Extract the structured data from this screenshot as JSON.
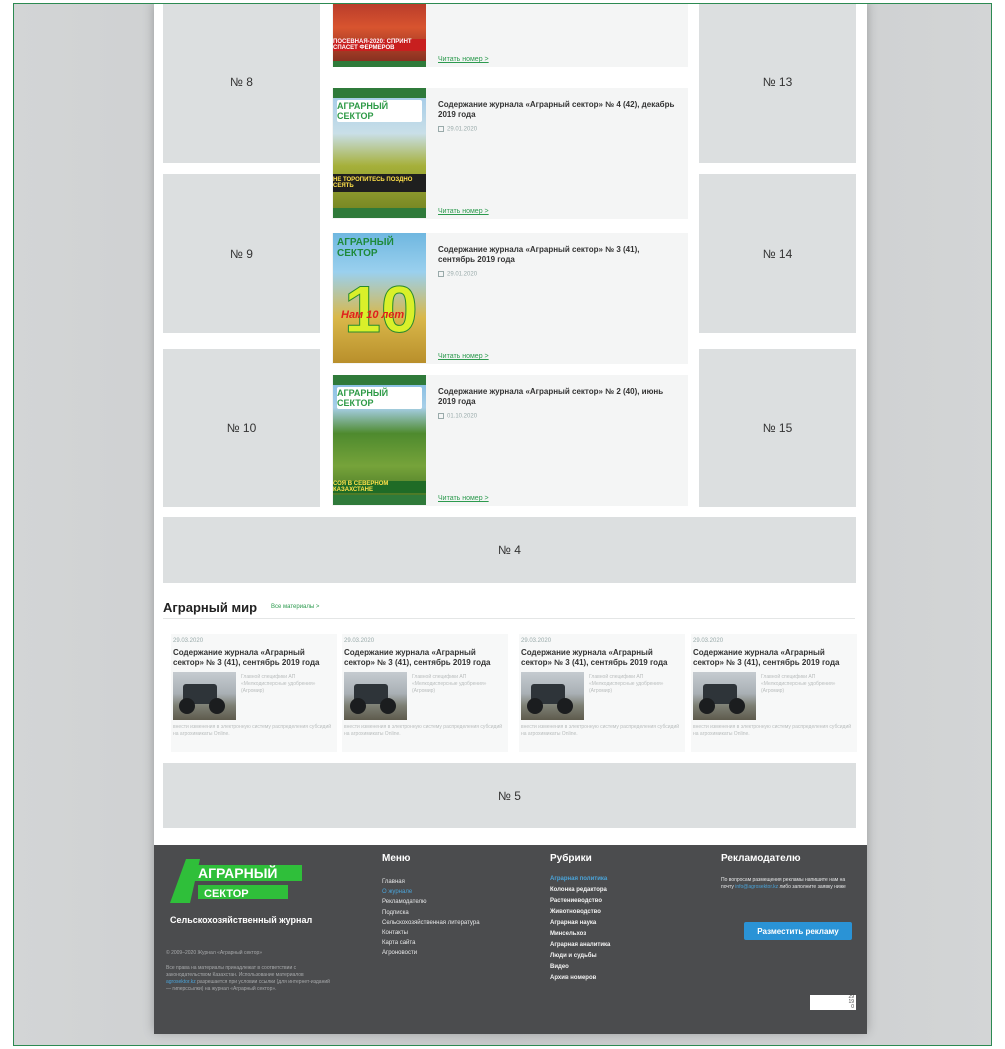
{
  "banners": {
    "b8": "№ 8",
    "b9": "№ 9",
    "b10": "№ 10",
    "b13": "№ 13",
    "b14": "№ 14",
    "b15": "№ 15",
    "b4": "№ 4",
    "b5": "№ 5"
  },
  "magazine_items": [
    {
      "title": "",
      "date": "",
      "read_more": "Читать номер >",
      "cover_text": "ПОСЕВНАЯ-2020: СПРИНТ СПАСЕТ ФЕРМЕРОВ"
    },
    {
      "title": "Содержание журнала «Аграрный сектор» № 4 (42), декабрь 2019 года",
      "date": "29.01.2020",
      "read_more": "Читать номер >",
      "cover_logo": "АГРАРНЫЙ СЕКТОР",
      "cover_text": "НЕ ТОРОПИТЕСЬ ПОЗДНО СЕЯТЬ"
    },
    {
      "title": "Содержание журнала «Аграрный сектор» № 3 (41), сентябрь 2019 года",
      "date": "29.01.2020",
      "read_more": "Читать номер >",
      "cover_logo": "АГРАРНЫЙ СЕКТОР",
      "cover_text": "Нам 10 лет"
    },
    {
      "title": "Содержание журнала «Аграрный сектор» № 2 (40), июнь 2019 года",
      "date": "01.10.2020",
      "read_more": "Читать номер >",
      "cover_logo": "АГРАРНЫЙ СЕКТОР",
      "cover_text": "СОЯ В СЕВЕРНОМ КАЗАХСТАНЕ"
    }
  ],
  "agro_world": {
    "title": "Аграрный мир",
    "all_link": "Все материалы >",
    "cards": [
      {
        "date": "29.03.2020",
        "title": "Содержание журнала «Аграрный сектор» № 3 (41), сентябрь 2019 года",
        "text_a": "Главной специфики АП «Мелкодисперсные удобрения» (Агромир)",
        "text_b": "внести изменения в электронную систему распределения субсидий на агрохимикаты Online."
      },
      {
        "date": "29.03.2020",
        "title": "Содержание журнала «Аграрный сектор» № 3 (41), сентябрь 2019 года",
        "text_a": "Главной специфики АП «Мелкодисперсные удобрения» (Агромир)",
        "text_b": "внести изменения в электронную систему распределения субсидий на агрохимикаты Online."
      },
      {
        "date": "29.03.2020",
        "title": "Содержание журнала «Аграрный сектор» № 3 (41), сентябрь 2019 года",
        "text_a": "Главной специфики АП «Мелкодисперсные удобрения» (Агромир)",
        "text_b": "внести изменения в электронную систему распределения субсидий на агрохимикаты Online."
      },
      {
        "date": "29.03.2020",
        "title": "Содержание журнала «Аграрный сектор» № 3 (41), сентябрь 2019 года",
        "text_a": "Главной специфики АП «Мелкодисперсные удобрения» (Агромир)",
        "text_b": "внести изменения в электронную систему распределения субсидий на агрохимикаты Online."
      }
    ]
  },
  "footer": {
    "logo_top": "АГРАРНЫЙ",
    "logo_bottom": "СЕКТОР",
    "subtitle": "Сельскохозяйственный журнал",
    "copyright": "© 2009–2020 Журнал «Аграрный сектор»",
    "rights_a": "Все права на материалы принадлежат в соответствии с законодательством Казахстан. Использование материалов",
    "rights_link": "agrosektor.kz",
    "rights_b": "разрешается при условии ссылки (для интернет-изданий — гиперссылки) на журнал «Аграрный сектор».",
    "menu_title": "Меню",
    "menu": [
      "Главная",
      "О журнале",
      "Рекламодателю",
      "Подписка",
      "Сельскохозяйственная литература",
      "Контакты",
      "Карта сайта",
      "Агроновости"
    ],
    "rubrics_title": "Рубрики",
    "rubrics": [
      "Аграрная политика",
      "Колонка редактора",
      "Растениеводство",
      "Животноводство",
      "Аграрная наука",
      "Минсельхоз",
      "Аграрная аналитика",
      "Люди и судьбы",
      "Видео",
      "Архив номеров"
    ],
    "adv_title": "Рекламодателю",
    "adv_text_a": "По вопросам размещения рекламы напишите нам на почту",
    "adv_email": "info@agrosektor.kz",
    "adv_text_b": "либо заполните заявку ниже",
    "adv_button": "Разместить рекламу",
    "counter": [
      "29",
      "19",
      "0"
    ]
  },
  "colors": {
    "brand_green": "#2c9a4e",
    "footer_bg": "#4b4c4e",
    "button_blue": "#2a93d6",
    "banner_gray": "#dcdfe0"
  }
}
